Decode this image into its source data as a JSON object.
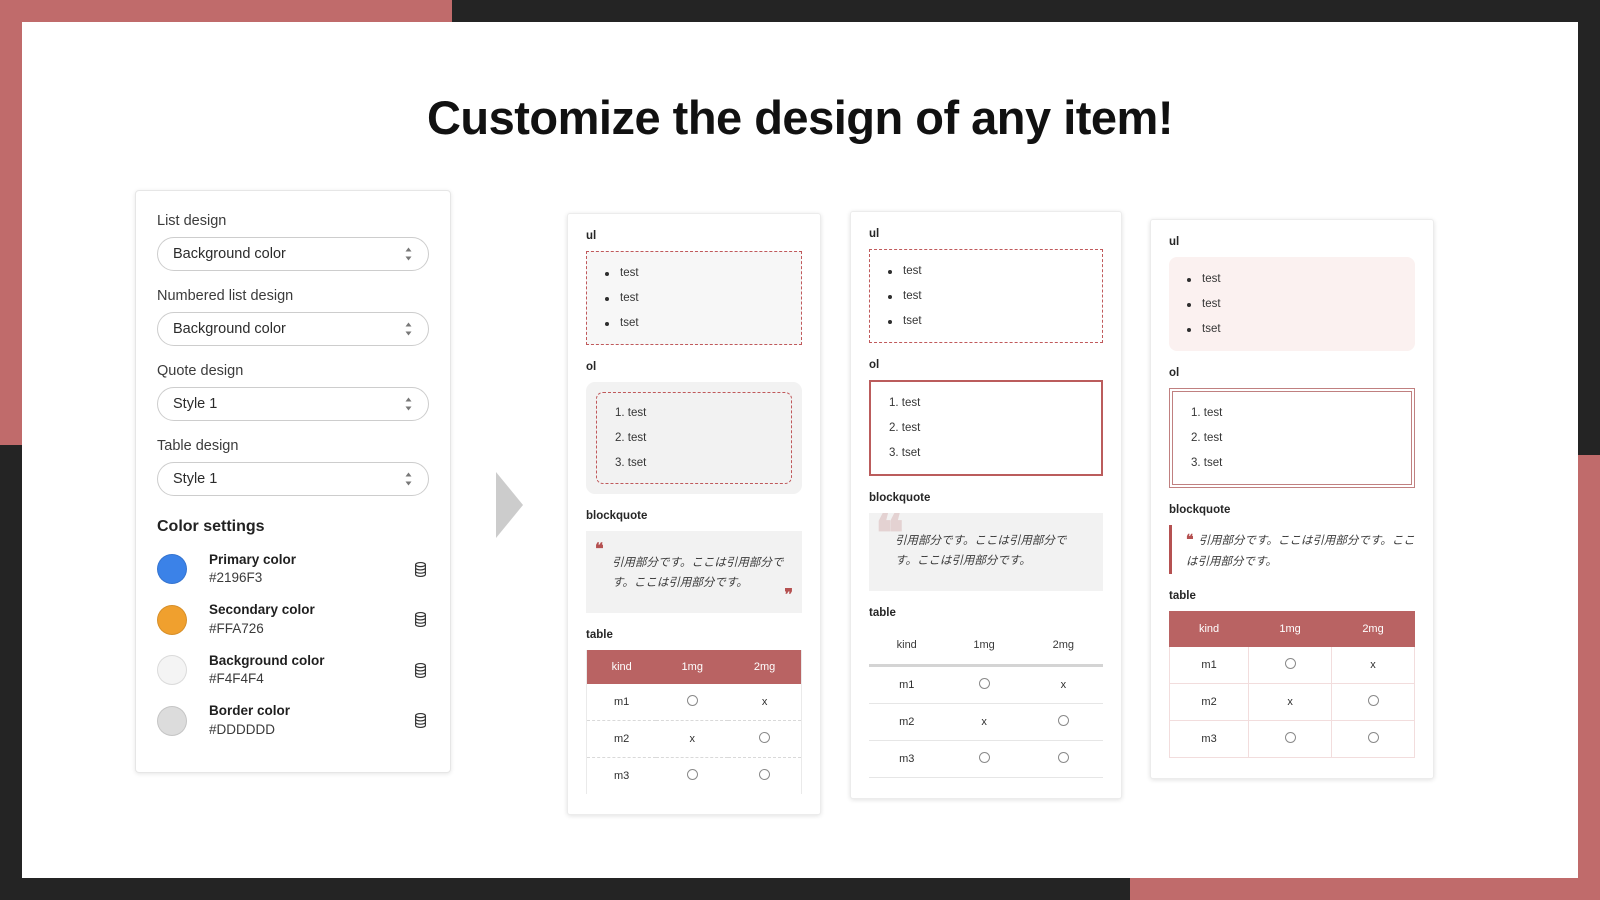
{
  "frame": {
    "accent_red": "#C06B6B",
    "dark": "#242424"
  },
  "title": "Customize the design of any item!",
  "settings_panel": {
    "fields": [
      {
        "label": "List design",
        "value": "Background color"
      },
      {
        "label": "Numbered list design",
        "value": "Background color"
      },
      {
        "label": "Quote design",
        "value": "Style 1"
      },
      {
        "label": "Table design",
        "value": "Style 1"
      }
    ],
    "color_settings_title": "Color settings",
    "colors": [
      {
        "name": "Primary color",
        "hex": "#2196F3",
        "swatch": "#3b82e8"
      },
      {
        "name": "Secondary color",
        "hex": "#FFA726",
        "swatch": "#f0a02e"
      },
      {
        "name": "Background color",
        "hex": "#F4F4F4",
        "swatch": "#f4f4f4"
      },
      {
        "name": "Border color",
        "hex": "#DDDDDD",
        "swatch": "#dcdcdc"
      }
    ],
    "icon": "database-icon"
  },
  "arrow": "right-triangle-arrow",
  "previews": {
    "labels": {
      "ul": "ul",
      "ol": "ol",
      "blockquote": "blockquote",
      "table": "table"
    },
    "ul_items": [
      "test",
      "test",
      "tset"
    ],
    "ol_items": [
      "test",
      "test",
      "tset"
    ],
    "quote_text": "引用部分です。ここは引用部分です。ここは引用部分です。",
    "quote_open": "❝",
    "quote_close": "❞",
    "table": {
      "headers": [
        "kind",
        "1mg",
        "2mg"
      ],
      "rows": [
        {
          "kind": "m1",
          "c1": "circle",
          "c2": "x"
        },
        {
          "kind": "m2",
          "c1": "x",
          "c2": "circle"
        },
        {
          "kind": "m3",
          "c1": "circle",
          "c2": "circle"
        }
      ],
      "x_mark": "x"
    },
    "cards": [
      {
        "id": "card-1",
        "ul_style": "dashed-on-gray",
        "ol_style": "dashed-rounded-on-gray",
        "quote_style": "gray-box-with-quotes",
        "table_style": "filled-header-dashed-rows"
      },
      {
        "id": "card-2",
        "ul_style": "dashed-plain",
        "ol_style": "solid-red-border",
        "quote_style": "gray-box-watermark",
        "table_style": "minimal-rules"
      },
      {
        "id": "card-3",
        "ul_style": "tinted-rounded",
        "ol_style": "double-red-border",
        "quote_style": "left-bar",
        "table_style": "full-grid"
      }
    ]
  }
}
